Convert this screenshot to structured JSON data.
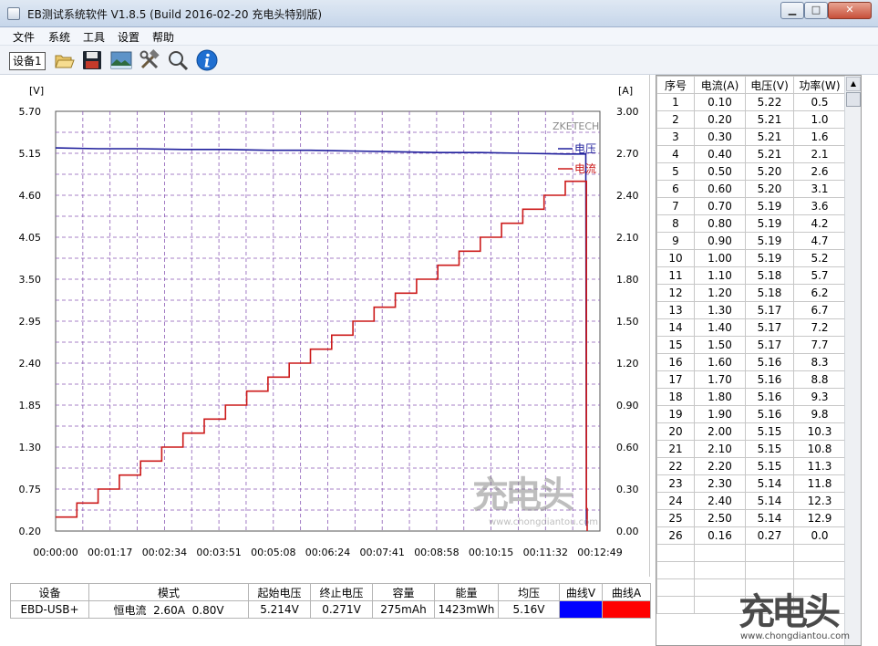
{
  "window": {
    "title": "EB测试系统软件 V1.8.5 (Build 2016-02-20 充电头特别版)",
    "buttons": {
      "minimize": "▁",
      "maximize": "□",
      "close": "✕"
    }
  },
  "menu": [
    "文件",
    "系统",
    "工具",
    "设置",
    "帮助"
  ],
  "toolbar": {
    "device_tab": "设备1",
    "tools": [
      "open-folder-icon",
      "save-disk-icon",
      "landscape-picture-icon",
      "tools-icon",
      "magnifier-icon",
      "info-icon"
    ]
  },
  "chart_data": {
    "type": "line",
    "brand": "ZKETECH",
    "y_left": {
      "unit": "[V]",
      "ticks": [
        "5.70",
        "5.15",
        "4.60",
        "4.05",
        "3.50",
        "2.95",
        "2.40",
        "1.85",
        "1.30",
        "0.75",
        "0.20"
      ],
      "ylim": [
        0.2,
        5.7
      ]
    },
    "y_right": {
      "unit": "[A]",
      "ticks": [
        "3.00",
        "2.70",
        "2.40",
        "2.10",
        "1.80",
        "1.50",
        "1.20",
        "0.90",
        "0.60",
        "0.30",
        "0.00"
      ],
      "ylim": [
        0.0,
        3.0
      ]
    },
    "x_ticks": [
      "00:00:00",
      "00:01:17",
      "00:02:34",
      "00:03:51",
      "00:05:08",
      "00:06:24",
      "00:07:41",
      "00:08:58",
      "00:10:15",
      "00:11:32",
      "00:12:49"
    ],
    "xlim_seconds": [
      0,
      769
    ],
    "legend": {
      "voltage": "电压",
      "current": "电流",
      "placement": "top-right"
    },
    "colors": {
      "voltage": "#1f1f9c",
      "current": "#cc1a1a"
    },
    "series": [
      {
        "name": "电压",
        "axis": "left",
        "x_seconds": [
          0,
          60,
          120,
          180,
          240,
          300,
          360,
          420,
          480,
          540,
          600,
          660,
          720,
          740,
          749,
          750
        ],
        "values": [
          5.22,
          5.21,
          5.21,
          5.2,
          5.2,
          5.19,
          5.19,
          5.18,
          5.17,
          5.16,
          5.16,
          5.15,
          5.14,
          5.14,
          5.14,
          0.27
        ]
      },
      {
        "name": "电流",
        "axis": "right",
        "step_seconds": 30,
        "values": [
          0.1,
          0.2,
          0.3,
          0.4,
          0.5,
          0.6,
          0.7,
          0.8,
          0.9,
          1.0,
          1.1,
          1.2,
          1.3,
          1.4,
          1.5,
          1.6,
          1.7,
          1.8,
          1.9,
          2.0,
          2.1,
          2.2,
          2.3,
          2.4,
          2.5,
          0.16
        ]
      }
    ]
  },
  "table": {
    "headers": [
      "序号",
      "电流(A)",
      "电压(V)",
      "功率(W)"
    ],
    "rows": [
      [
        "1",
        "0.10",
        "5.22",
        "0.5"
      ],
      [
        "2",
        "0.20",
        "5.21",
        "1.0"
      ],
      [
        "3",
        "0.30",
        "5.21",
        "1.6"
      ],
      [
        "4",
        "0.40",
        "5.21",
        "2.1"
      ],
      [
        "5",
        "0.50",
        "5.20",
        "2.6"
      ],
      [
        "6",
        "0.60",
        "5.20",
        "3.1"
      ],
      [
        "7",
        "0.70",
        "5.19",
        "3.6"
      ],
      [
        "8",
        "0.80",
        "5.19",
        "4.2"
      ],
      [
        "9",
        "0.90",
        "5.19",
        "4.7"
      ],
      [
        "10",
        "1.00",
        "5.19",
        "5.2"
      ],
      [
        "11",
        "1.10",
        "5.18",
        "5.7"
      ],
      [
        "12",
        "1.20",
        "5.18",
        "6.2"
      ],
      [
        "13",
        "1.30",
        "5.17",
        "6.7"
      ],
      [
        "14",
        "1.40",
        "5.17",
        "7.2"
      ],
      [
        "15",
        "1.50",
        "5.17",
        "7.7"
      ],
      [
        "16",
        "1.60",
        "5.16",
        "8.3"
      ],
      [
        "17",
        "1.70",
        "5.16",
        "8.8"
      ],
      [
        "18",
        "1.80",
        "5.16",
        "9.3"
      ],
      [
        "19",
        "1.90",
        "5.16",
        "9.8"
      ],
      [
        "20",
        "2.00",
        "5.15",
        "10.3"
      ],
      [
        "21",
        "2.10",
        "5.15",
        "10.8"
      ],
      [
        "22",
        "2.20",
        "5.15",
        "11.3"
      ],
      [
        "23",
        "2.30",
        "5.14",
        "11.8"
      ],
      [
        "24",
        "2.40",
        "5.14",
        "12.3"
      ],
      [
        "25",
        "2.50",
        "5.14",
        "12.9"
      ],
      [
        "26",
        "0.16",
        "0.27",
        "0.0"
      ]
    ]
  },
  "summary": {
    "headers": [
      "设备",
      "模式",
      "起始电压",
      "终止电压",
      "容量",
      "能量",
      "均压",
      "曲线V",
      "曲线A"
    ],
    "values": [
      "EBD-USB+",
      "恒电流  2.60A  0.80V",
      "5.214V",
      "0.271V",
      "275mAh",
      "1423mWh",
      "5.16V"
    ],
    "curve_colors": {
      "v": "#0000ff",
      "a": "#ff0000"
    }
  }
}
